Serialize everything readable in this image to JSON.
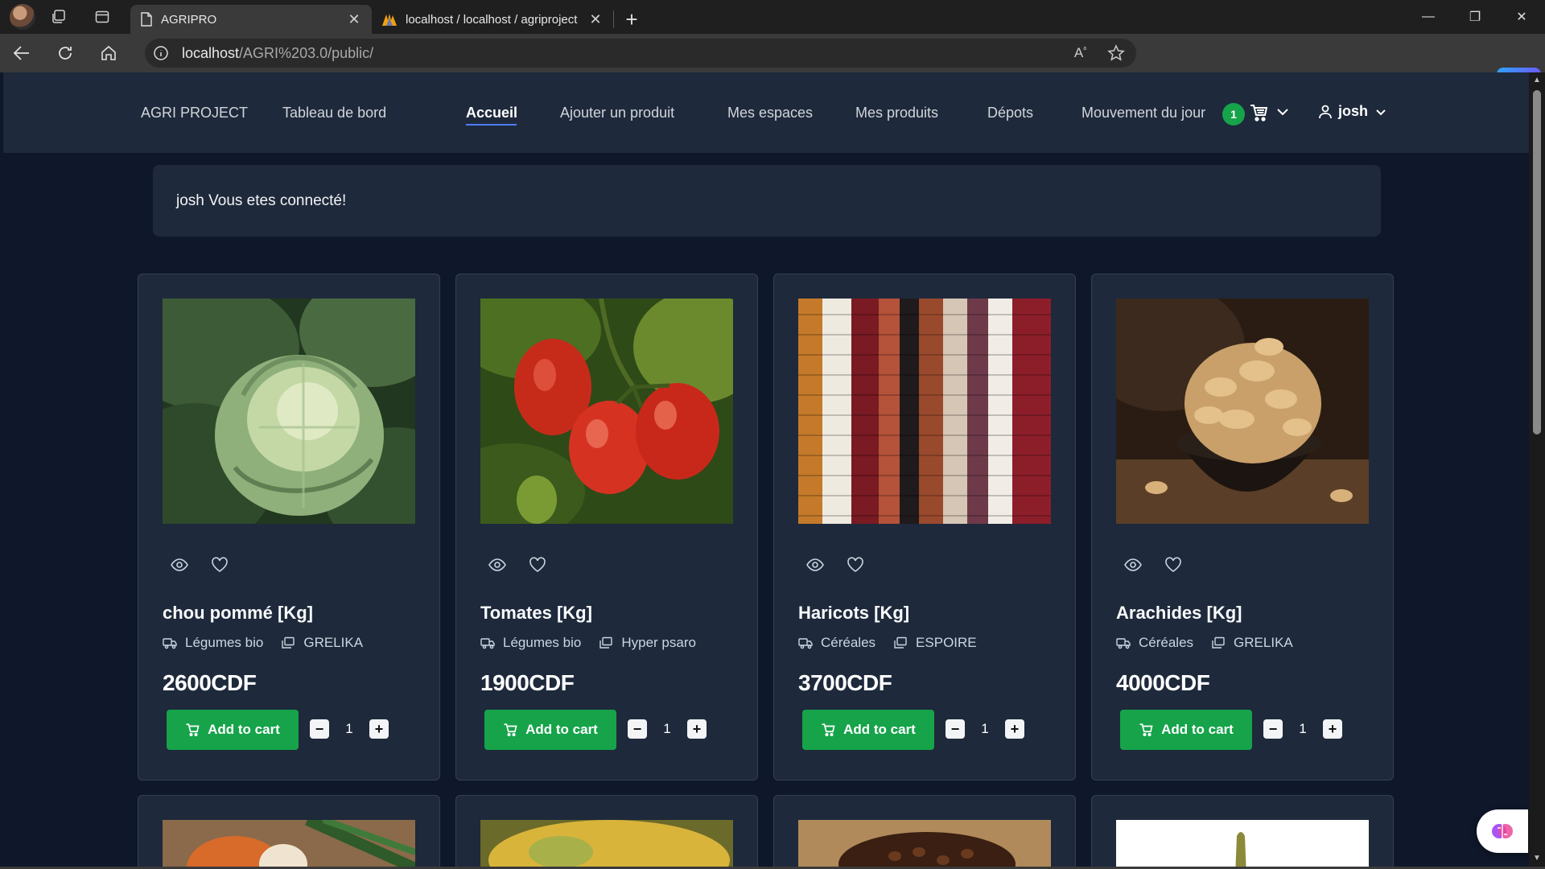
{
  "browser": {
    "tabs": [
      {
        "title": "AGRIPRO",
        "active": true
      },
      {
        "title": "localhost / localhost / agriproject",
        "active": false
      }
    ],
    "url_host": "localhost",
    "url_path": "/AGRI%203.0/public/"
  },
  "app": {
    "nav": {
      "brand": "AGRI PROJECT",
      "dashboard": "Tableau de bord",
      "home": "Accueil",
      "add_product": "Ajouter un produit",
      "spaces": "Mes espaces",
      "products": "Mes produits",
      "depots": "Dépots",
      "daily_movement": "Mouvement du jour",
      "cart_count": "1",
      "user": "josh"
    },
    "alert": "josh Vous etes connecté!",
    "products": [
      {
        "name": "chou pommé [Kg]",
        "category": "Légumes bio",
        "depot": "GRELIKA",
        "price": "2600CDF",
        "qty": "1",
        "add_label": "Add to cart"
      },
      {
        "name": "Tomates [Kg]",
        "category": "Légumes bio",
        "depot": "Hyper psaro",
        "price": "1900CDF",
        "qty": "1",
        "add_label": "Add to cart"
      },
      {
        "name": "Haricots [Kg]",
        "category": "Céréales",
        "depot": "ESPOIRE",
        "price": "3700CDF",
        "qty": "1",
        "add_label": "Add to cart"
      },
      {
        "name": "Arachides [Kg]",
        "category": "Céréales",
        "depot": "GRELIKA",
        "price": "4000CDF",
        "qty": "1",
        "add_label": "Add to cart"
      }
    ]
  },
  "colors": {
    "page_bg": "#0f172a",
    "card_bg": "#1e293b",
    "accent_green": "#16a34a",
    "nav_underline": "#4f7cff"
  }
}
